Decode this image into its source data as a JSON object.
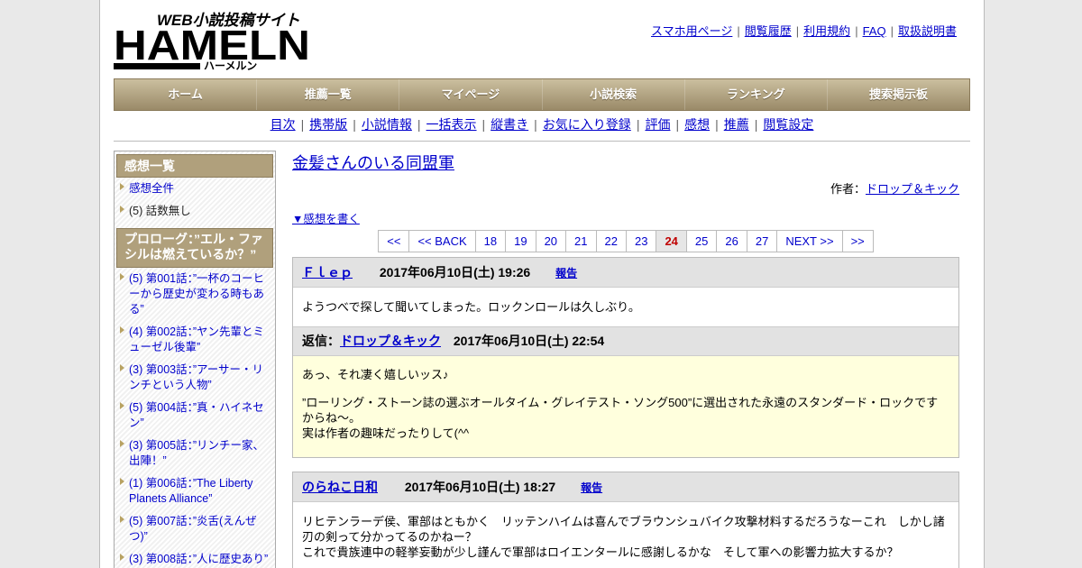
{
  "header": {
    "logo_text_small": "WEB小説投稿サイト",
    "logo_text_main": "HAMELN",
    "logo_text_kana": "ハーメルン",
    "top_links": [
      "スマホ用ページ",
      "閲覧履歴",
      "利用規約",
      "FAQ",
      "取扱説明書"
    ]
  },
  "nav": [
    "ホーム",
    "推薦一覧",
    "マイページ",
    "小説検索",
    "ランキング",
    "捜索掲示板"
  ],
  "subnav": [
    "目次",
    "携帯版",
    "小説情報",
    "一括表示",
    "縦書き",
    "お気に入り登録",
    "評価",
    "感想",
    "推薦",
    "閲覧設定"
  ],
  "sidebar": {
    "head": "感想一覧",
    "top_items": [
      {
        "label": "感想全件",
        "link": true
      },
      {
        "label": "(5) 話数無し",
        "link": false
      }
    ],
    "section_head": "プロローグ：”エル・ファシルは燃えているか？”",
    "chapters": [
      "(5) 第001話：”一杯のコーヒーから歴史が変わる時もある”",
      "(4) 第002話：”ヤン先輩とミューゼル後輩”",
      "(3) 第003話：”アーサー・リンチという人物”",
      "(5) 第004話：”真・ハイネセン”",
      "(3) 第005話：”リンチー家、出陣！”",
      "(1) 第006話：”The Liberty Planets Alliance”",
      "(5) 第007話：”炎舌(えんぜつ)”",
      "(3) 第008話：”人に歴史あり”"
    ]
  },
  "main": {
    "title": "金髪さんのいる同盟軍",
    "author_label": "作者：",
    "author_name": "ドロップ＆キック",
    "write_link": "▼感想を書く",
    "pager": [
      "<<",
      "<< BACK",
      "18",
      "19",
      "20",
      "21",
      "22",
      "23",
      "24",
      "25",
      "26",
      "27",
      "NEXT >>",
      ">>"
    ],
    "pager_current": "24",
    "comments": [
      {
        "name": "Ｆｌｅｐ",
        "date": "2017年06月10日(土) 19:26",
        "report": "報告",
        "body": [
          "ようつべで探して聞いてしまった。ロックンロールは久しぶり。"
        ],
        "reply": {
          "label": "返信：",
          "name": "ドロップ＆キック",
          "date": "2017年06月10日(土) 22:54",
          "lines": [
            "あっ、それ凄く嬉しいッス♪",
            "”ローリング・ストーン誌の選ぶオールタイム・グレイテスト・ソング500”に選出された永遠のスタンダード・ロックですからね～。",
            "実は作者の趣味だったりして(^^"
          ]
        }
      },
      {
        "name": "のらねこ日和",
        "date": "2017年06月10日(土) 18:27",
        "report": "報告",
        "body": [
          "リヒテンラーデ侯、軍部はともかく　リッテンハイムは喜んでブラウンシュバイク攻撃材料するだろうなーこれ　しかし諸刃の剣って分かってるのかねー？",
          "これで貴族連中の軽挙妄動が少し謹んで軍部はロイエンタールに感謝しるかな　そして軍への影響力拡大するか？"
        ]
      }
    ]
  },
  "colors": {
    "nav_bg": "#b0a07c",
    "link": "#0000cc",
    "reply_bg": "#ffffdd",
    "current_page": "#c00000"
  }
}
